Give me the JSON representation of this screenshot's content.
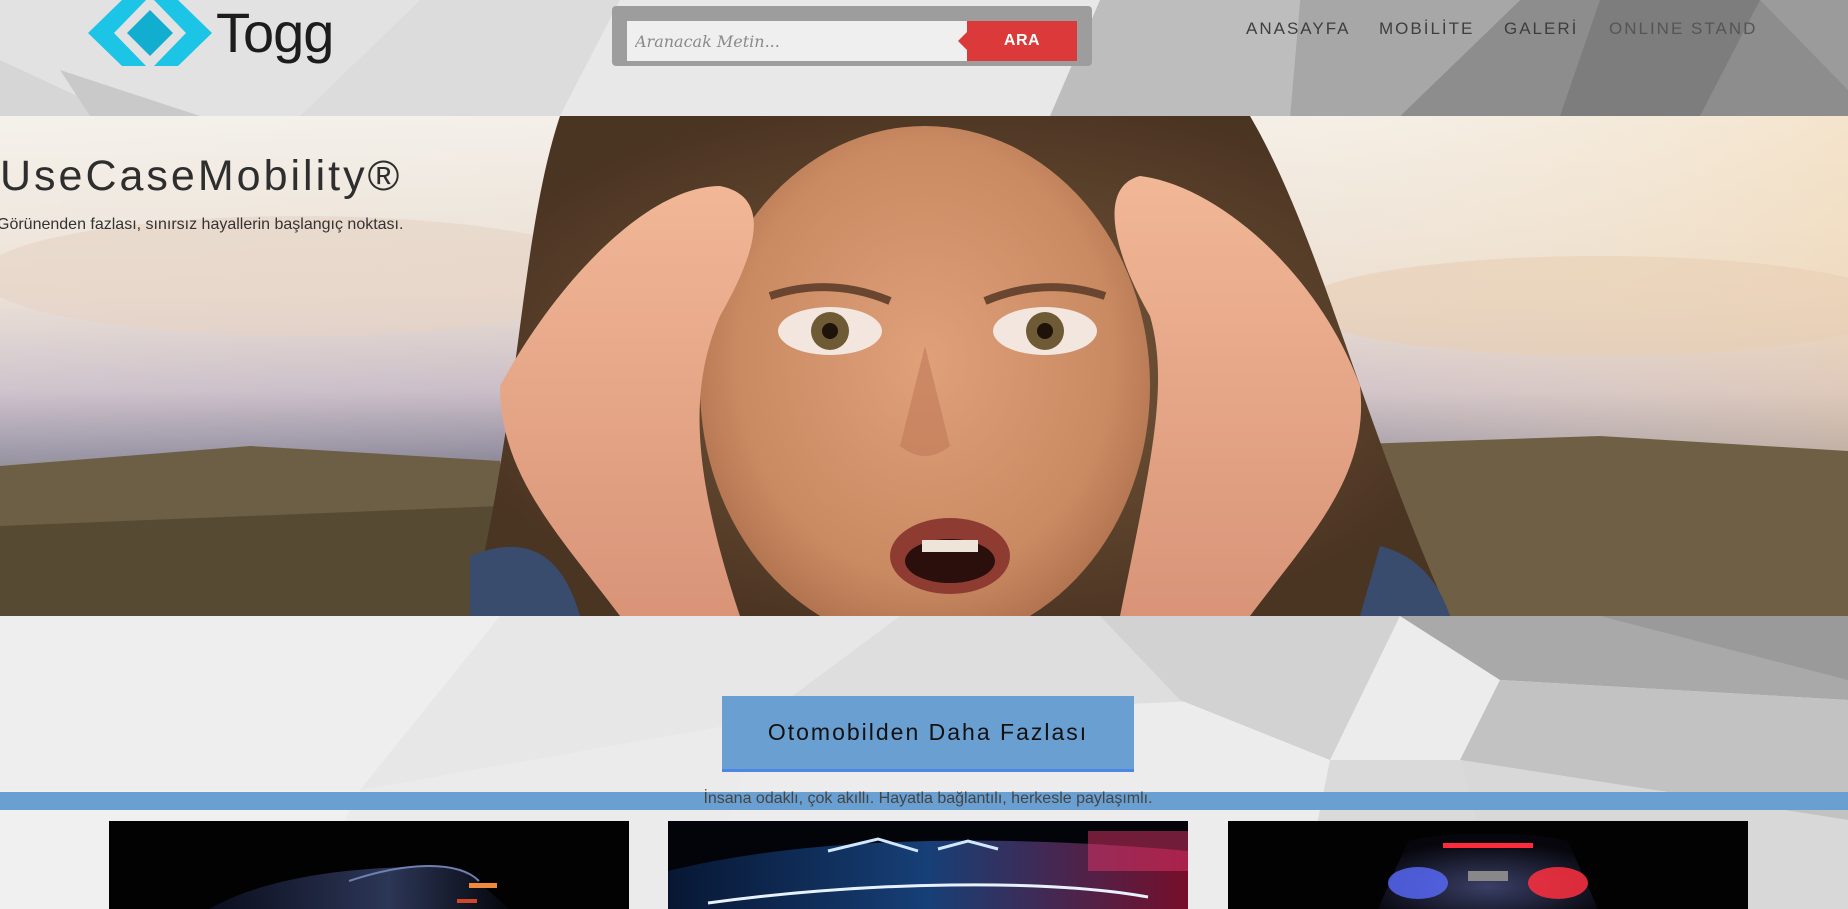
{
  "brand": {
    "name": "Togg",
    "accent": "#1cc4e6"
  },
  "search": {
    "placeholder": "Aranacak Metin...",
    "button_label": "ARA",
    "button_color": "#dc3a3a"
  },
  "nav": {
    "items": [
      {
        "label": "ANASAYFA"
      },
      {
        "label": "MOBİLİTE"
      },
      {
        "label": "GALERİ"
      },
      {
        "label": "ONLINE STAND"
      }
    ]
  },
  "hero": {
    "title": "UseCaseMobility®",
    "subtitle": "Görünenden fazlası, sınırsız hayallerin başlangıç noktası."
  },
  "cta": {
    "label": "Otomobilden Daha Fazlası",
    "tagline": "İnsana odaklı, çok akıllı. Hayatla bağlantılı, herkesle paylaşımlı.",
    "color": "#6a9fd1"
  },
  "cards": [
    {
      "icon": "car-side-photo"
    },
    {
      "icon": "car-lights-photo"
    },
    {
      "icon": "car-rear-photo"
    }
  ]
}
